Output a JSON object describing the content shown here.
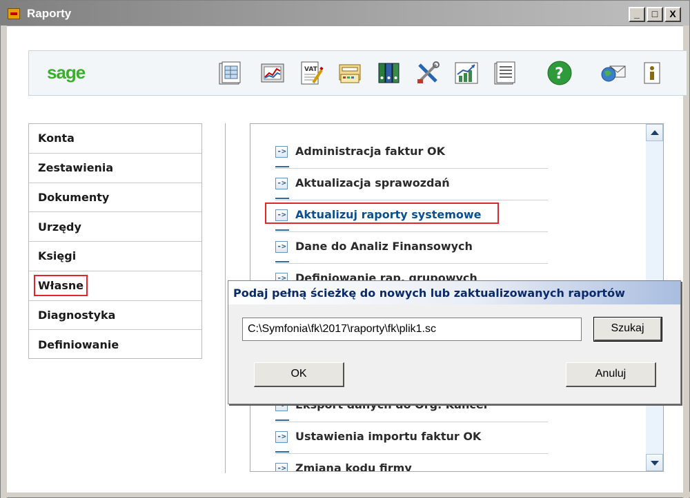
{
  "window": {
    "title": "Raporty",
    "minimize": "_",
    "maximize": "□",
    "close": "X"
  },
  "toolbar": {
    "logo": "sage",
    "icons": [
      "documents-icon",
      "chart-icon",
      "vat-icon",
      "calculator-icon",
      "binders-icon",
      "tools-icon",
      "growth-chart-icon",
      "list-icon",
      "help-icon",
      "globe-mail-icon",
      "info-icon"
    ]
  },
  "nav": {
    "items": [
      {
        "label": "Konta"
      },
      {
        "label": "Zestawienia"
      },
      {
        "label": "Dokumenty"
      },
      {
        "label": "Urzędy"
      },
      {
        "label": "Księgi"
      },
      {
        "label": "Własne"
      },
      {
        "label": "Diagnostyka"
      },
      {
        "label": "Definiowanie"
      }
    ],
    "active": "Własne"
  },
  "reports": {
    "items": [
      {
        "label": "Administracja faktur OK"
      },
      {
        "label": "Aktualizacja sprawozdań"
      },
      {
        "label": "Aktualizuj raporty systemowe"
      },
      {
        "label": "Dane do Analiz Finansowych"
      },
      {
        "label": "Definiowanie rap. grupowych"
      },
      {
        "label": "Eksport danych do Org. Kancel"
      },
      {
        "label": "Ustawienia importu faktur OK"
      },
      {
        "label": "Zmiana kodu firmy"
      }
    ],
    "arrow": "->"
  },
  "dialog": {
    "title": "Podaj pełną ścieżkę do nowych lub zaktualizowanych raportów",
    "path_value": "C:\\Symfonia\\fk\\2017\\raporty\\fk\\plik1.sc",
    "search_label": "Szukaj",
    "ok_label": "OK",
    "cancel_label": "Anuluj"
  }
}
